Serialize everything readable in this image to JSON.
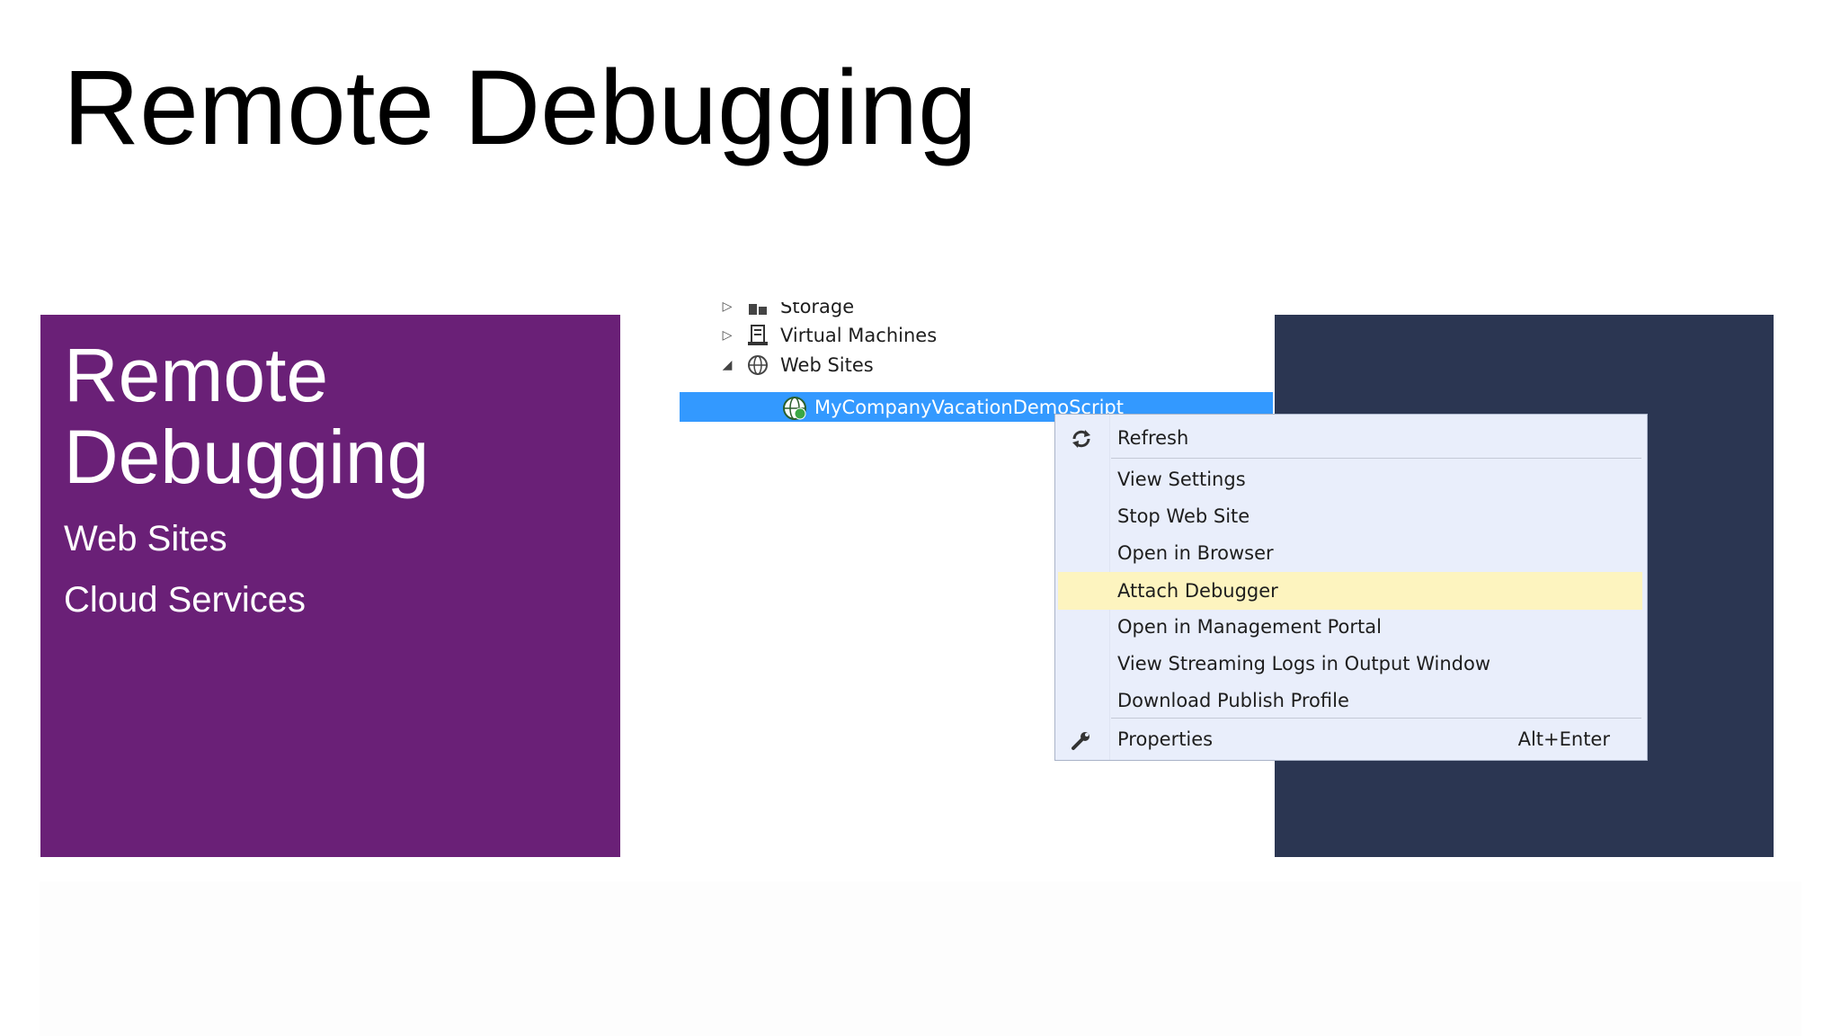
{
  "slide": {
    "title": "Remote Debugging"
  },
  "left_panel": {
    "heading": "Remote Debugging",
    "items": [
      "Web Sites",
      "Cloud Services"
    ]
  },
  "tree": {
    "nodes": [
      {
        "label": "Storage",
        "icon": "storage-icon",
        "arrow": "▷"
      },
      {
        "label": "Virtual Machines",
        "icon": "virtual-machines-icon",
        "arrow": "▷"
      },
      {
        "label": "Web Sites",
        "icon": "web-sites-icon",
        "arrow": "◢"
      },
      {
        "label": "MyCompanyVacationDemoScript",
        "icon": "website-globe-icon",
        "selected": true
      }
    ]
  },
  "context_menu": {
    "items": [
      {
        "label": "Refresh",
        "icon": "refresh-icon"
      },
      {
        "label": "View Settings"
      },
      {
        "label": "Stop Web Site"
      },
      {
        "label": "Open in Browser"
      },
      {
        "label": "Attach Debugger",
        "highlighted": true
      },
      {
        "label": "Open in Management Portal"
      },
      {
        "label": "View Streaming Logs in Output Window"
      },
      {
        "label": "Download Publish Profile"
      },
      {
        "label": "Properties",
        "icon": "wrench-icon",
        "shortcut": "Alt+Enter"
      }
    ]
  },
  "colors": {
    "purple_panel": "#6a2077",
    "navy_panel": "#2b3652",
    "selection": "#3399ff",
    "menu_background": "#e9eefb",
    "menu_highlight": "#fdf4bf"
  }
}
